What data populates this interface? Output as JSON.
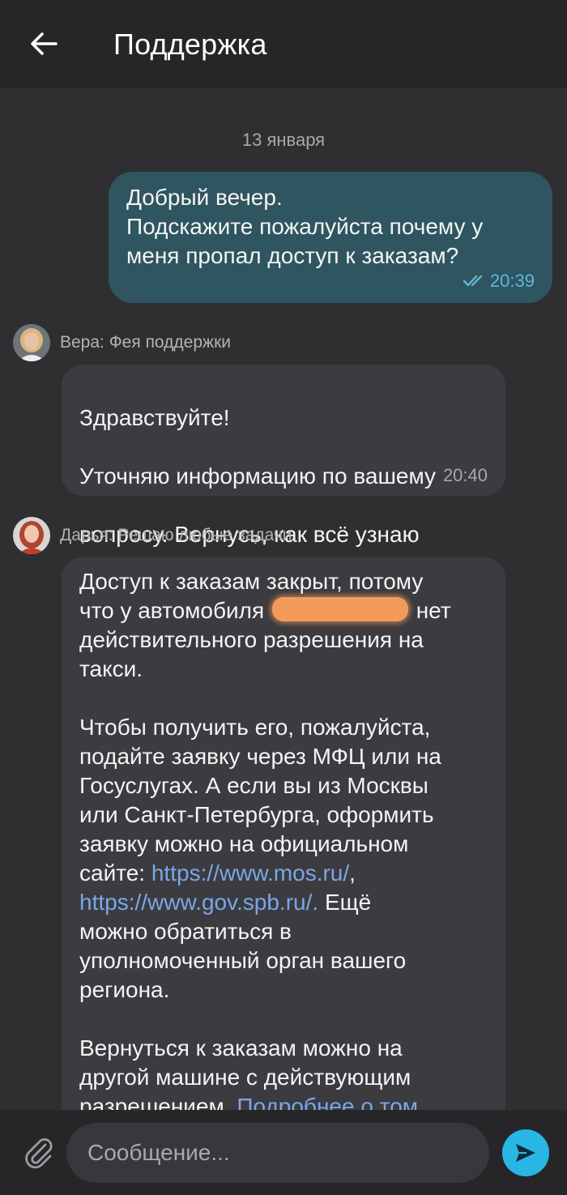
{
  "header": {
    "title": "Поддержка",
    "back_icon": "arrow-left-icon"
  },
  "chat": {
    "date_separator": "13 января",
    "outgoing": {
      "lines": [
        "Добрый вечер.",
        "Подскажите пожалуйста почему у",
        "меня пропал доступ к заказам?"
      ],
      "time": "20:39",
      "status_icon": "double-check-icon"
    },
    "vera": {
      "sender": "Вера: Фея поддержки",
      "lines": [
        "Здравствуйте!",
        "Уточняю информацию по вашему",
        "вопросу. Вернусь, как всё узнаю"
      ],
      "time": "20:40"
    },
    "darya": {
      "sender": "Дарья: Решаю любые задачи",
      "p1_a": "Доступ к заказам закрыт, потому",
      "p1_b": "что у автомобиля",
      "p1_c": "нет",
      "p1_d": "действительного разрешения на",
      "p1_e": "такси.",
      "p2_a": "Чтобы получить его, пожалуйста,",
      "p2_b": "подайте заявку через МФЦ или на",
      "p2_c": "Госуслугах. А если вы из Москвы",
      "p2_d": "или Санкт-Петербурга, оформить",
      "p2_e": "заявку можно на официальном",
      "p2_f": "сайте:",
      "link1": "https://www.mos.ru/",
      "comma": ",",
      "link2": "https://www.gov.spb.ru/.",
      "p2_g": "Ещё",
      "p2_h": "можно обратиться в",
      "p2_i": "уполномоченный орган вашего",
      "p2_j": "региона.",
      "p3_a": "Вернуться к заказам можно на",
      "p3_b": "другой машине с действующим",
      "p3_c": "разрешением.",
      "link3": "Подробнее о том,"
    }
  },
  "input_bar": {
    "placeholder": "Сообщение...",
    "attach_icon": "paperclip-icon",
    "send_icon": "send-icon"
  },
  "colors": {
    "background": "#2f2f31",
    "header": "#262628",
    "outgoing_bubble": "#2f5560",
    "incoming_bubble": "#3b3b40",
    "link": "#7aa7e6",
    "send_button": "#2ab6e4",
    "redaction": "#f29a5a"
  }
}
